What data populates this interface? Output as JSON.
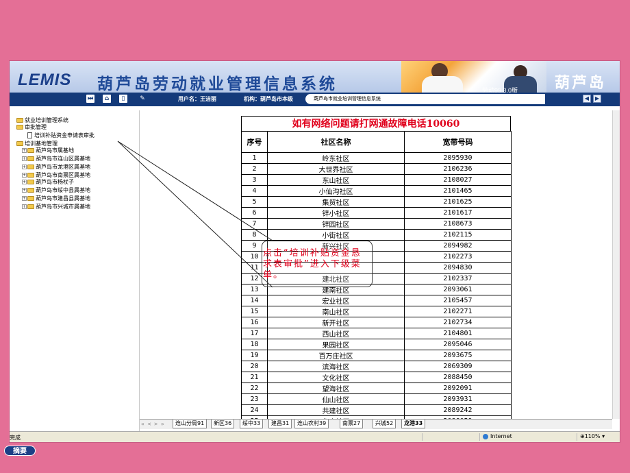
{
  "app": {
    "logo": "LEMIS",
    "system_title": "葫芦岛劳动就业管理信息系统",
    "right_title": "葫芦岛",
    "slogan": "劳动99 3.0版",
    "user_label": "用户名：王洁丽",
    "org_label": "机构：葫芦岛市本级",
    "system_tab": "葫芦岛市就业培训管理信息系统",
    "toolbar_icons": [
      "fast-forward-icon",
      "home-icon",
      "document-icon",
      "pen-icon"
    ]
  },
  "tree": {
    "items": [
      {
        "label": "就业培训管理系统",
        "type": "folder",
        "indent": 0
      },
      {
        "label": "审批管理",
        "type": "folder",
        "indent": 0
      },
      {
        "label": "培训补贴资金申请表审批",
        "type": "doc",
        "indent": 2
      },
      {
        "label": "培训基地管理",
        "type": "folder",
        "indent": 0
      },
      {
        "label": "葫芦岛市属基地",
        "type": "folder-plus",
        "indent": 1
      },
      {
        "label": "葫芦岛市连山区属基地",
        "type": "folder-plus",
        "indent": 1
      },
      {
        "label": "葫芦岛市龙港区属基地",
        "type": "folder-plus",
        "indent": 1
      },
      {
        "label": "葫芦岛市南票区属基地",
        "type": "folder-plus",
        "indent": 1
      },
      {
        "label": "葫芦岛市杨杖子",
        "type": "folder-plus",
        "indent": 1
      },
      {
        "label": "葫芦岛市绥中县属基地",
        "type": "folder-plus",
        "indent": 1
      },
      {
        "label": "葫芦岛市建昌县属基地",
        "type": "folder-plus",
        "indent": 1
      },
      {
        "label": "葫芦岛市兴城市属基地",
        "type": "folder-plus",
        "indent": 1
      }
    ]
  },
  "sheet": {
    "banner": "如有网络问题请打网通故障电话10060",
    "columns": [
      "序号",
      "社区名称",
      "宽带号码"
    ],
    "rows": [
      [
        "1",
        "岭东社区",
        "2095930"
      ],
      [
        "2",
        "大世界社区",
        "2106236"
      ],
      [
        "3",
        "东山社区",
        "2108027"
      ],
      [
        "4",
        "小仙沟社区",
        "2101465"
      ],
      [
        "5",
        "集贸社区",
        "2101625"
      ],
      [
        "6",
        "锌小社区",
        "2101617"
      ],
      [
        "7",
        "锌园社区",
        "2108673"
      ],
      [
        "8",
        "小街社区",
        "2102115"
      ],
      [
        "9",
        "新兴社区",
        "2094982"
      ],
      [
        "10",
        "",
        "2102273"
      ],
      [
        "11",
        "",
        "2094830"
      ],
      [
        "12",
        "建北社区",
        "2102337"
      ],
      [
        "13",
        "建南社区",
        "2093061"
      ],
      [
        "14",
        "宏业社区",
        "2105457"
      ],
      [
        "15",
        "南山社区",
        "2102271"
      ],
      [
        "16",
        "新开社区",
        "2102734"
      ],
      [
        "17",
        "西山社区",
        "2104801"
      ],
      [
        "18",
        "果园社区",
        "2095046"
      ],
      [
        "19",
        "百万庄社区",
        "2093675"
      ],
      [
        "20",
        "滨海社区",
        "2069309"
      ],
      [
        "21",
        "文化社区",
        "2088450"
      ],
      [
        "22",
        "望海社区",
        "2092091"
      ],
      [
        "23",
        "仙山社区",
        "2093931"
      ],
      [
        "24",
        "共建社区",
        "2089242"
      ],
      [
        "25",
        "象山社区",
        "2086059"
      ]
    ],
    "tab_nav": "« < > »",
    "tabs": [
      "连山分局91",
      "新区36",
      "绥中33",
      "建昌31",
      "连山农村39",
      "南票27",
      "兴城52",
      "龙港33"
    ],
    "active_tab": "龙港33"
  },
  "callout": {
    "text": "点击“培训补贴资金恳求表审批”进入下级菜单。"
  },
  "status": {
    "left": "完成",
    "zone": "Internet",
    "zoom": "110%"
  },
  "footer": {
    "summary_button": "摘要"
  }
}
